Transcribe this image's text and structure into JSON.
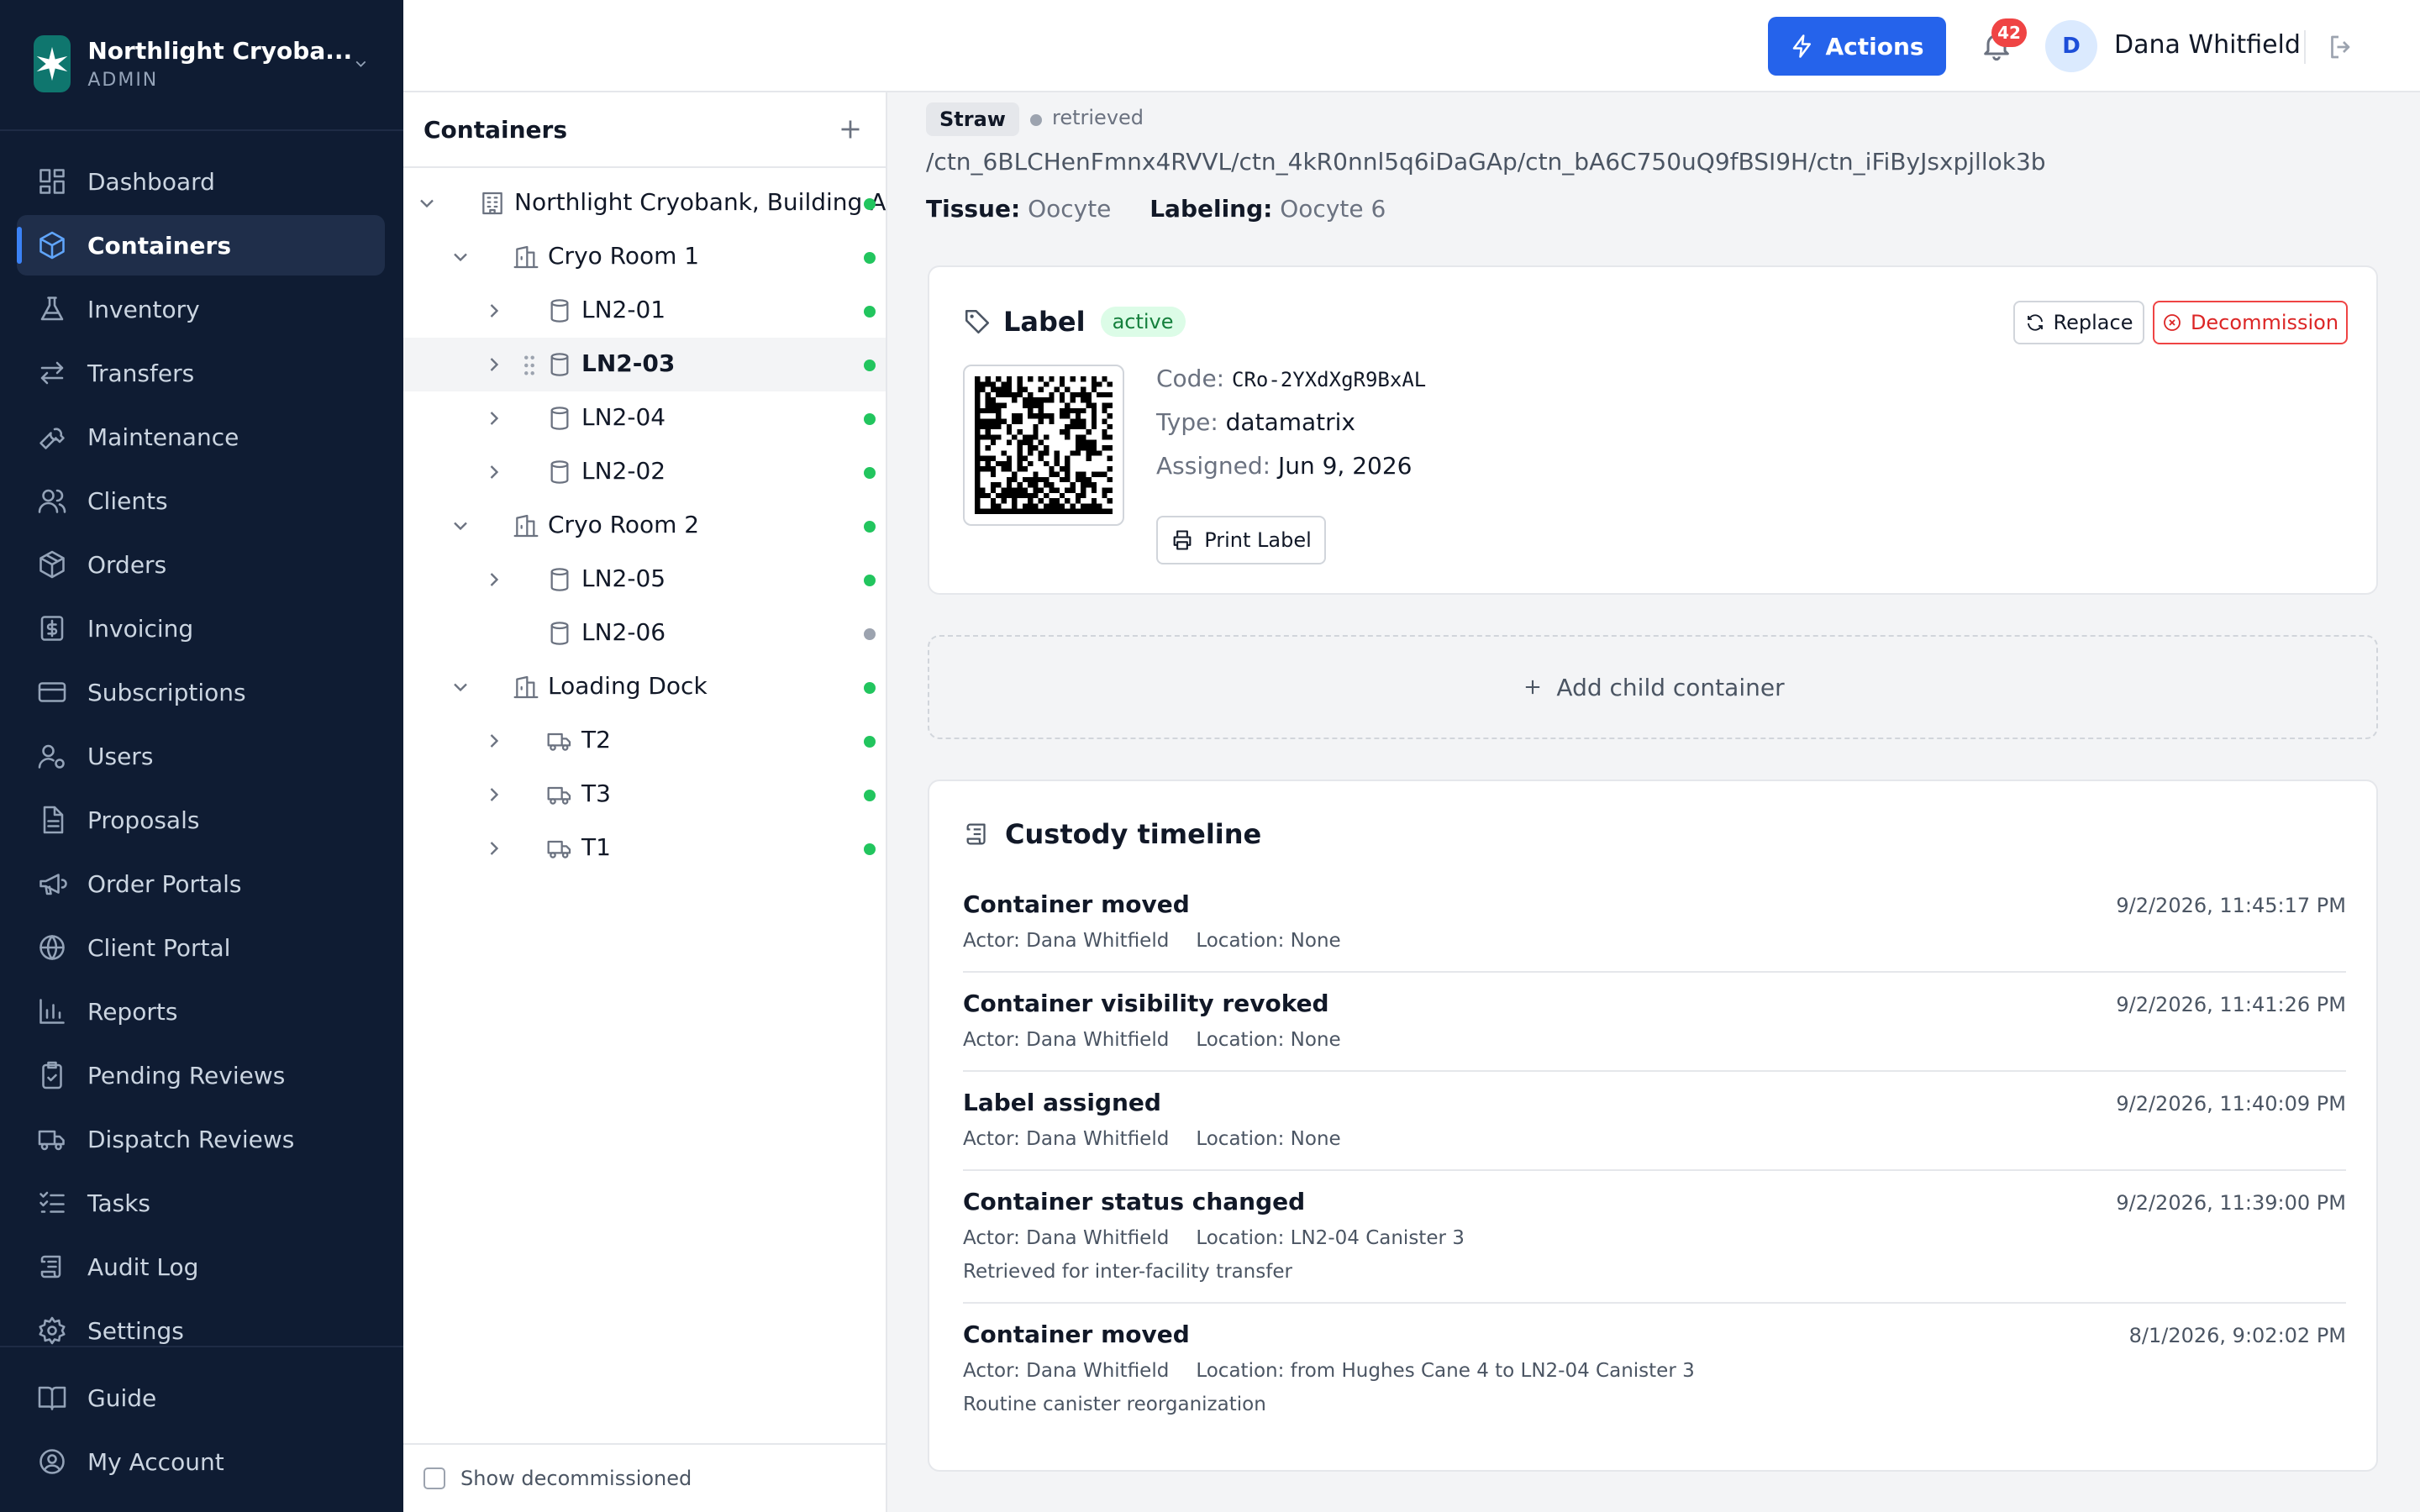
{
  "org": {
    "name": "Northlight Cryoba...",
    "role": "ADMIN"
  },
  "nav": [
    {
      "label": "Dashboard",
      "icon": "dashboard-icon"
    },
    {
      "label": "Containers",
      "icon": "box-icon",
      "active": true
    },
    {
      "label": "Inventory",
      "icon": "flask-icon"
    },
    {
      "label": "Transfers",
      "icon": "transfer-icon"
    },
    {
      "label": "Maintenance",
      "icon": "wrench-icon"
    },
    {
      "label": "Clients",
      "icon": "users-icon"
    },
    {
      "label": "Orders",
      "icon": "package-icon"
    },
    {
      "label": "Invoicing",
      "icon": "dollar-receipt-icon"
    },
    {
      "label": "Subscriptions",
      "icon": "card-icon"
    },
    {
      "label": "Users",
      "icon": "user-cog-icon"
    },
    {
      "label": "Proposals",
      "icon": "document-icon"
    },
    {
      "label": "Order Portals",
      "icon": "megaphone-icon"
    },
    {
      "label": "Client Portal",
      "icon": "globe-icon"
    },
    {
      "label": "Reports",
      "icon": "bar-chart-icon"
    },
    {
      "label": "Pending Reviews",
      "icon": "clipboard-check-icon"
    },
    {
      "label": "Dispatch Reviews",
      "icon": "truck-icon"
    },
    {
      "label": "Tasks",
      "icon": "list-check-icon"
    },
    {
      "label": "Audit Log",
      "icon": "scroll-icon"
    },
    {
      "label": "Settings",
      "icon": "gear-icon"
    }
  ],
  "nav_bottom": [
    {
      "label": "Guide",
      "icon": "book-icon"
    },
    {
      "label": "My Account",
      "icon": "user-circle-icon"
    }
  ],
  "topbar": {
    "actions_label": "Actions",
    "notifications_count": "42",
    "user_initial": "D",
    "user_name": "Dana Whitfield"
  },
  "tree": {
    "title": "Containers",
    "show_decommissioned_label": "Show decommissioned",
    "rows": [
      {
        "label": "Northlight Cryobank, Building A",
        "level": 0,
        "icon": "building-icon",
        "expanded": true,
        "has_children": true,
        "status": "green"
      },
      {
        "label": "Cryo Room 1",
        "level": 1,
        "icon": "room-icon",
        "expanded": true,
        "has_children": true,
        "status": "green"
      },
      {
        "label": "LN2-01",
        "level": 2,
        "icon": "tank-icon",
        "expanded": false,
        "has_children": true,
        "status": "green"
      },
      {
        "label": "LN2-03",
        "level": 2,
        "icon": "tank-icon",
        "expanded": false,
        "has_children": true,
        "status": "green",
        "selected": true
      },
      {
        "label": "LN2-04",
        "level": 2,
        "icon": "tank-icon",
        "expanded": false,
        "has_children": true,
        "status": "green"
      },
      {
        "label": "LN2-02",
        "level": 2,
        "icon": "tank-icon",
        "expanded": false,
        "has_children": true,
        "status": "green"
      },
      {
        "label": "Cryo Room 2",
        "level": 1,
        "icon": "room-icon",
        "expanded": true,
        "has_children": true,
        "status": "green"
      },
      {
        "label": "LN2-05",
        "level": 2,
        "icon": "tank-icon",
        "expanded": false,
        "has_children": true,
        "status": "green"
      },
      {
        "label": "LN2-06",
        "level": 2,
        "icon": "tank-icon",
        "expanded": false,
        "has_children": false,
        "status": "gray"
      },
      {
        "label": "Loading Dock",
        "level": 1,
        "icon": "room-icon",
        "expanded": true,
        "has_children": true,
        "status": "green"
      },
      {
        "label": "T2",
        "level": 2,
        "icon": "truck-icon",
        "expanded": false,
        "has_children": true,
        "status": "green"
      },
      {
        "label": "T3",
        "level": 2,
        "icon": "truck-icon",
        "expanded": false,
        "has_children": true,
        "status": "green"
      },
      {
        "label": "T1",
        "level": 2,
        "icon": "truck-icon",
        "expanded": false,
        "has_children": true,
        "status": "green"
      }
    ]
  },
  "container": {
    "type": "Straw",
    "status": "retrieved",
    "path": "/ctn_6BLCHenFmnx4RVVL/ctn_4kR0nnl5q6iDaGAp/ctn_bA6C750uQ9fBSI9H/ctn_iFiByJsxpjllok3b",
    "tissue_label": "Tissue:",
    "tissue": "Oocyte",
    "labeling_label": "Labeling:",
    "labeling": "Oocyte 6"
  },
  "label_card": {
    "title": "Label",
    "badge": "active",
    "replace_label": "Replace",
    "decommission_label": "Decommission",
    "code_label": "Code:",
    "code": "CRo-2YXdXgR9BxAL",
    "type_label": "Type:",
    "type": "datamatrix",
    "assigned_label": "Assigned:",
    "assigned": "Jun 9, 2026",
    "print_label": "Print Label"
  },
  "add_child_label": "Add child container",
  "timeline": {
    "title": "Custody timeline",
    "events": [
      {
        "title": "Container moved",
        "time": "9/2/2026, 11:45:17 PM",
        "actor": "Actor: Dana Whitfield",
        "location": "Location: None",
        "note": ""
      },
      {
        "title": "Container visibility revoked",
        "time": "9/2/2026, 11:41:26 PM",
        "actor": "Actor: Dana Whitfield",
        "location": "Location: None",
        "note": ""
      },
      {
        "title": "Label assigned",
        "time": "9/2/2026, 11:40:09 PM",
        "actor": "Actor: Dana Whitfield",
        "location": "Location: None",
        "note": ""
      },
      {
        "title": "Container status changed",
        "time": "9/2/2026, 11:39:00 PM",
        "actor": "Actor: Dana Whitfield",
        "location": "Location: LN2-04 Canister 3",
        "note": "Retrieved for inter-facility transfer"
      },
      {
        "title": "Container moved",
        "time": "8/1/2026, 9:02:02 PM",
        "actor": "Actor: Dana Whitfield",
        "location": "Location: from Hughes Cane 4 to LN2-04 Canister 3",
        "note": "Routine canister reorganization"
      }
    ]
  },
  "colors": {
    "sidebar_bg": "#0f1c33",
    "accent": "#2563eb",
    "status_green": "#22c55e",
    "danger": "#ef4444"
  }
}
